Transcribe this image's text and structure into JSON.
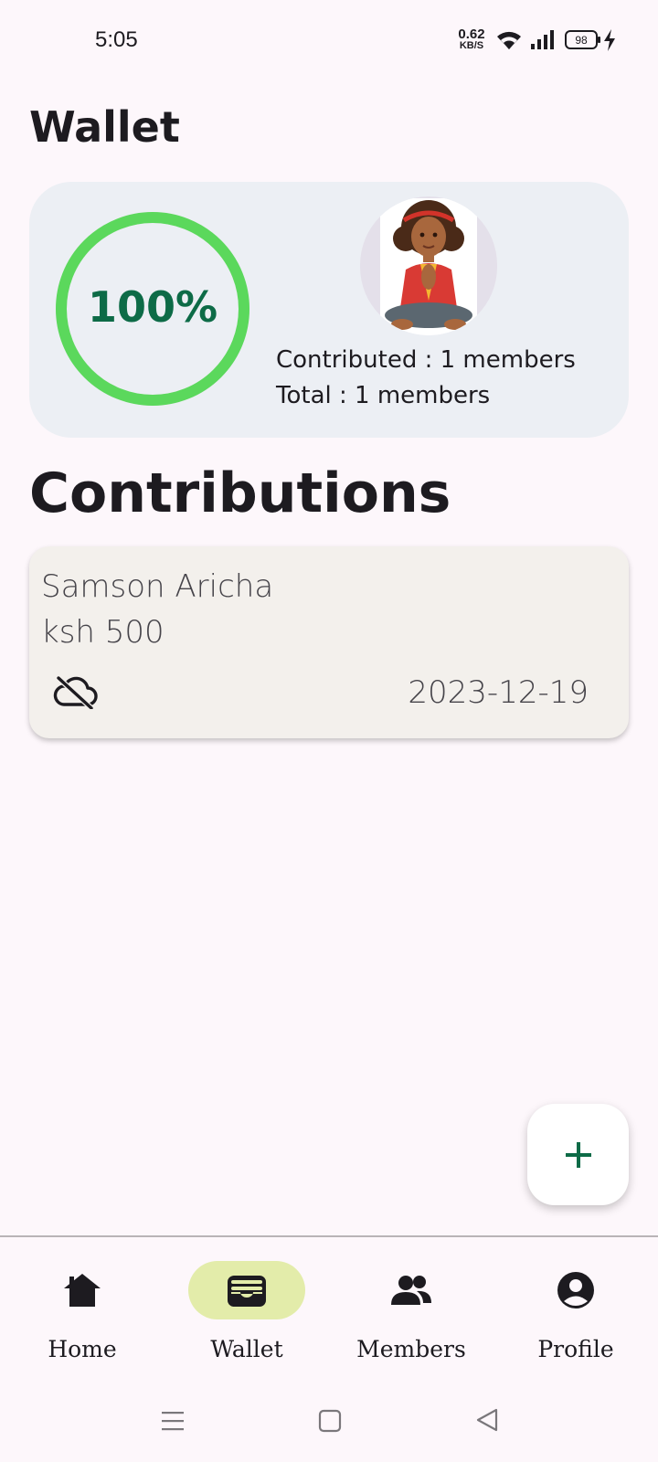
{
  "status_bar": {
    "time": "5:05",
    "net_speed_value": "0.62",
    "net_speed_unit": "KB/S",
    "battery_level": "98",
    "icons": [
      "wifi-icon",
      "signal-icon",
      "battery-icon",
      "charging-bolt-icon"
    ]
  },
  "page": {
    "title": "Wallet"
  },
  "wallet_summary": {
    "progress_label": "100%",
    "progress_fraction": 1.0,
    "progress_color": "#5bd85c",
    "contributed_text": "Contributed : 1 members",
    "total_text": "Total : 1 members"
  },
  "contributions": {
    "heading": "Contributions",
    "items": [
      {
        "name": "Samson Aricha",
        "amount": "ksh 500",
        "date": "2023-12-19",
        "sync_icon": "cloud-off-icon"
      }
    ]
  },
  "fab": {
    "icon": "plus-icon",
    "color": "#0d6b47"
  },
  "bottom_nav": {
    "items": [
      {
        "label": "Home",
        "icon": "home-icon",
        "active": false
      },
      {
        "label": "Wallet",
        "icon": "wallet-icon",
        "active": true
      },
      {
        "label": "Members",
        "icon": "people-icon",
        "active": false
      },
      {
        "label": "Profile",
        "icon": "account-circle-icon",
        "active": false
      }
    ],
    "active_color": "#e3ecaa"
  },
  "system_nav": {
    "icons": [
      "menu-icon",
      "home-square-icon",
      "back-icon"
    ]
  }
}
